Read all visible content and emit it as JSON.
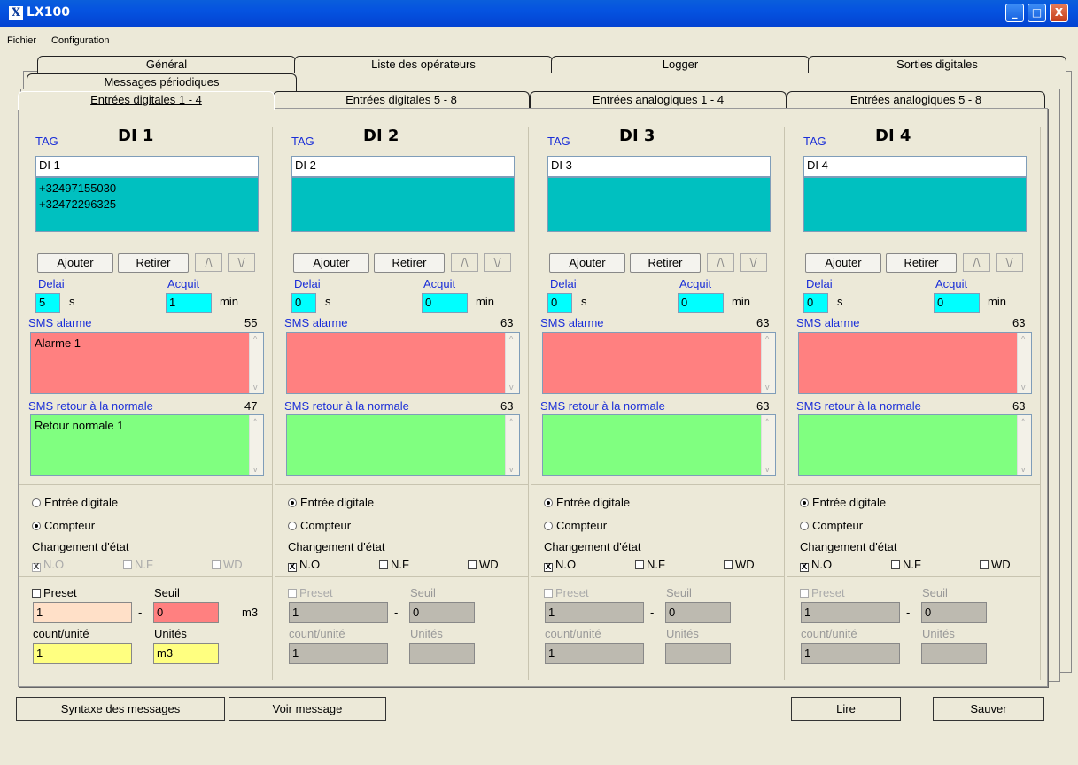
{
  "window": {
    "title": "LX100"
  },
  "menu": {
    "file": "Fichier",
    "config": "Configuration"
  },
  "tabs_row1": [
    "Général",
    "Liste des opérateurs",
    "Logger",
    "Sorties digitales"
  ],
  "tabs_row2": [
    "Messages périodiques"
  ],
  "tabs_row3": [
    "Entrées digitales 1 - 4",
    "Entrées digitales 5 - 8",
    "Entrées analogiques 1 - 4",
    "Entrées analogiques 5 - 8"
  ],
  "labels": {
    "tag": "TAG",
    "add": "Ajouter",
    "remove": "Retirer",
    "delay": "Delai",
    "ack": "Acquit",
    "s": "s",
    "min": "min",
    "sms_alarm": "SMS alarme",
    "sms_return": "SMS retour à la normale",
    "digital_input": "Entrée digitale",
    "counter": "Compteur",
    "state_change": "Changement d'état",
    "no": "N.O",
    "nf": "N.F",
    "wd": "WD",
    "preset": "Preset",
    "threshold": "Seuil",
    "count_unit": "count/unité",
    "units": "Unités",
    "dash": "-",
    "unit_m3": "m3",
    "up": "/\\",
    "down": "\\/"
  },
  "columns": [
    {
      "title": "DI 1",
      "tag": "DI 1",
      "phones": [
        "+32497155030",
        "+32472296325"
      ],
      "delay": "5",
      "ack": "1",
      "alarm_count": "55",
      "alarm_text": "Alarme 1",
      "return_count": "47",
      "return_text": "Retour normale 1",
      "mode": "counter",
      "no_checked": true,
      "preset": "1",
      "threshold": "0",
      "count_unit": "1",
      "units": "m3",
      "enabled": true
    },
    {
      "title": "DI 2",
      "tag": "DI 2",
      "phones": [
        "",
        ""
      ],
      "delay": "0",
      "ack": "0",
      "alarm_count": "63",
      "alarm_text": "",
      "return_count": "63",
      "return_text": "",
      "mode": "digital",
      "no_checked": true,
      "preset": "1",
      "threshold": "0",
      "count_unit": "1",
      "units": "",
      "enabled": false
    },
    {
      "title": "DI 3",
      "tag": "DI 3",
      "phones": [
        "",
        ""
      ],
      "delay": "0",
      "ack": "0",
      "alarm_count": "63",
      "alarm_text": "",
      "return_count": "63",
      "return_text": "",
      "mode": "digital",
      "no_checked": true,
      "preset": "1",
      "threshold": "0",
      "count_unit": "1",
      "units": "",
      "enabled": false
    },
    {
      "title": "DI 4",
      "tag": "DI 4",
      "phones": [
        "",
        ""
      ],
      "delay": "0",
      "ack": "0",
      "alarm_count": "63",
      "alarm_text": "",
      "return_count": "63",
      "return_text": "",
      "mode": "digital",
      "no_checked": true,
      "preset": "1",
      "threshold": "0",
      "count_unit": "1",
      "units": "",
      "enabled": false
    }
  ],
  "bottom": {
    "syntax": "Syntaxe des messages",
    "view": "Voir message",
    "read": "Lire",
    "save": "Sauver"
  },
  "colors": {
    "titlebar": "#0553e0",
    "cyan": "#00c0c0",
    "alarm": "#ff8080",
    "return": "#80ff80",
    "input_cyan": "#00ffff",
    "preset_bg": "#ffe0c8",
    "threshold_bg": "#ff8080",
    "yellow": "#ffff80"
  }
}
